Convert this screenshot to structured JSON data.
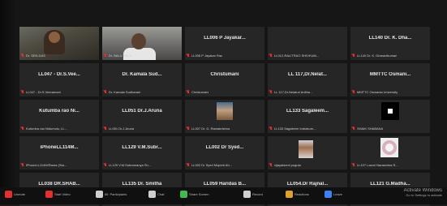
{
  "tiles": [
    {
      "name": "",
      "label": "Dr. SEN DAS",
      "kind": "video1",
      "active": true
    },
    {
      "name": "",
      "label": "Dr. BALU RAI K",
      "kind": "video2",
      "active": false
    },
    {
      "name": "LL006 P Jayakar...",
      "label": "LL006 P Jayakar Rao",
      "kind": "name"
    },
    {
      "name": "",
      "label": "LL012-RALITRAO SHIVKUM...",
      "kind": "blank"
    },
    {
      "name": "LL140 Dr. K. Dha...",
      "label": "LL140 Dr. K. Dharanikumari",
      "kind": "name"
    },
    {
      "name": "LL047 - Dr.S.Vee...",
      "label": "LL047 - Dr.S.Veeramani",
      "kind": "name"
    },
    {
      "name": "Dr. Kamala Sud...",
      "label": "Dr. Kamala Sudharani",
      "kind": "name"
    },
    {
      "name": "Christumani",
      "label": "Christumani",
      "kind": "name"
    },
    {
      "name": "LL 117,Dr.Nelat...",
      "label": "LL 117,Dr.Nelaturi Anitha ...",
      "kind": "name"
    },
    {
      "name": "MMTTC Osmani...",
      "label": "MMTTC Osmania University",
      "kind": "name"
    },
    {
      "name": "Kutumba rao Ni...",
      "label": "Kutumba rao Nidumolu, LL...",
      "kind": "name"
    },
    {
      "name": "LL051 Dr.J.Aruna",
      "label": "LL051 Dr.J.Aruna",
      "kind": "name"
    },
    {
      "name": "",
      "label": "LL007 Dr. D. Ramakrishna",
      "kind": "thumb",
      "thumb": "p1"
    },
    {
      "name": "LL133 Sagaleem...",
      "label": "LL133 Sagaleem Indrakum...",
      "kind": "name"
    },
    {
      "name": "",
      "label": "SHAIK SHABANA",
      "kind": "thumb",
      "thumb": "p3"
    },
    {
      "name": "iPhoneLL114M...",
      "label": "iPhoneLL114M/Rama (Sta...",
      "kind": "name"
    },
    {
      "name": "LL129 V.M.Subr...",
      "label": "LL129 V.M.Subramanya Sh...",
      "kind": "name"
    },
    {
      "name": "LL002 Dr Syed...",
      "label": "LL002 Dr Syed Mujeeb Ah...",
      "kind": "name"
    },
    {
      "name": "",
      "label": "vijayalaxmi pogula",
      "kind": "thumb",
      "thumb": "p2"
    },
    {
      "name": "",
      "label": "LL107 Laxmi Narasimha R...",
      "kind": "thumb",
      "thumb": "p4"
    },
    {
      "name": "LL038 DR.SHAB...",
      "label": "LL038 DR.SHABEER PATHA...",
      "kind": "name"
    },
    {
      "name": "LL135 Dr. Smitha",
      "label": "LL135 Dr. Smitha",
      "kind": "name"
    },
    {
      "name": "LL059 Haridas B...",
      "label": "LL059 Haridas Bodkhe",
      "kind": "name"
    },
    {
      "name": "LL054.Dr Rajnal...",
      "label": "LL054.Dr Rajnale Anilkumar",
      "kind": "name"
    },
    {
      "name": "LL121 G.Madha...",
      "label": "LL121 G.Madhavi...",
      "kind": "name"
    }
  ],
  "toolbar": {
    "mute": "Unmute",
    "video": "Start Video",
    "participants": "Participants",
    "count": "66",
    "chat": "Chat",
    "share": "Share Screen",
    "record": "Record",
    "reactions": "Reactions",
    "leave": "Leave"
  },
  "watermark": {
    "line1": "Activate Windows",
    "line2": "Go to Settings to activate"
  },
  "colors": {
    "background": "#161616",
    "tile": "#262626",
    "active_outline": "#c8e830",
    "mic_muted": "#e03030"
  }
}
